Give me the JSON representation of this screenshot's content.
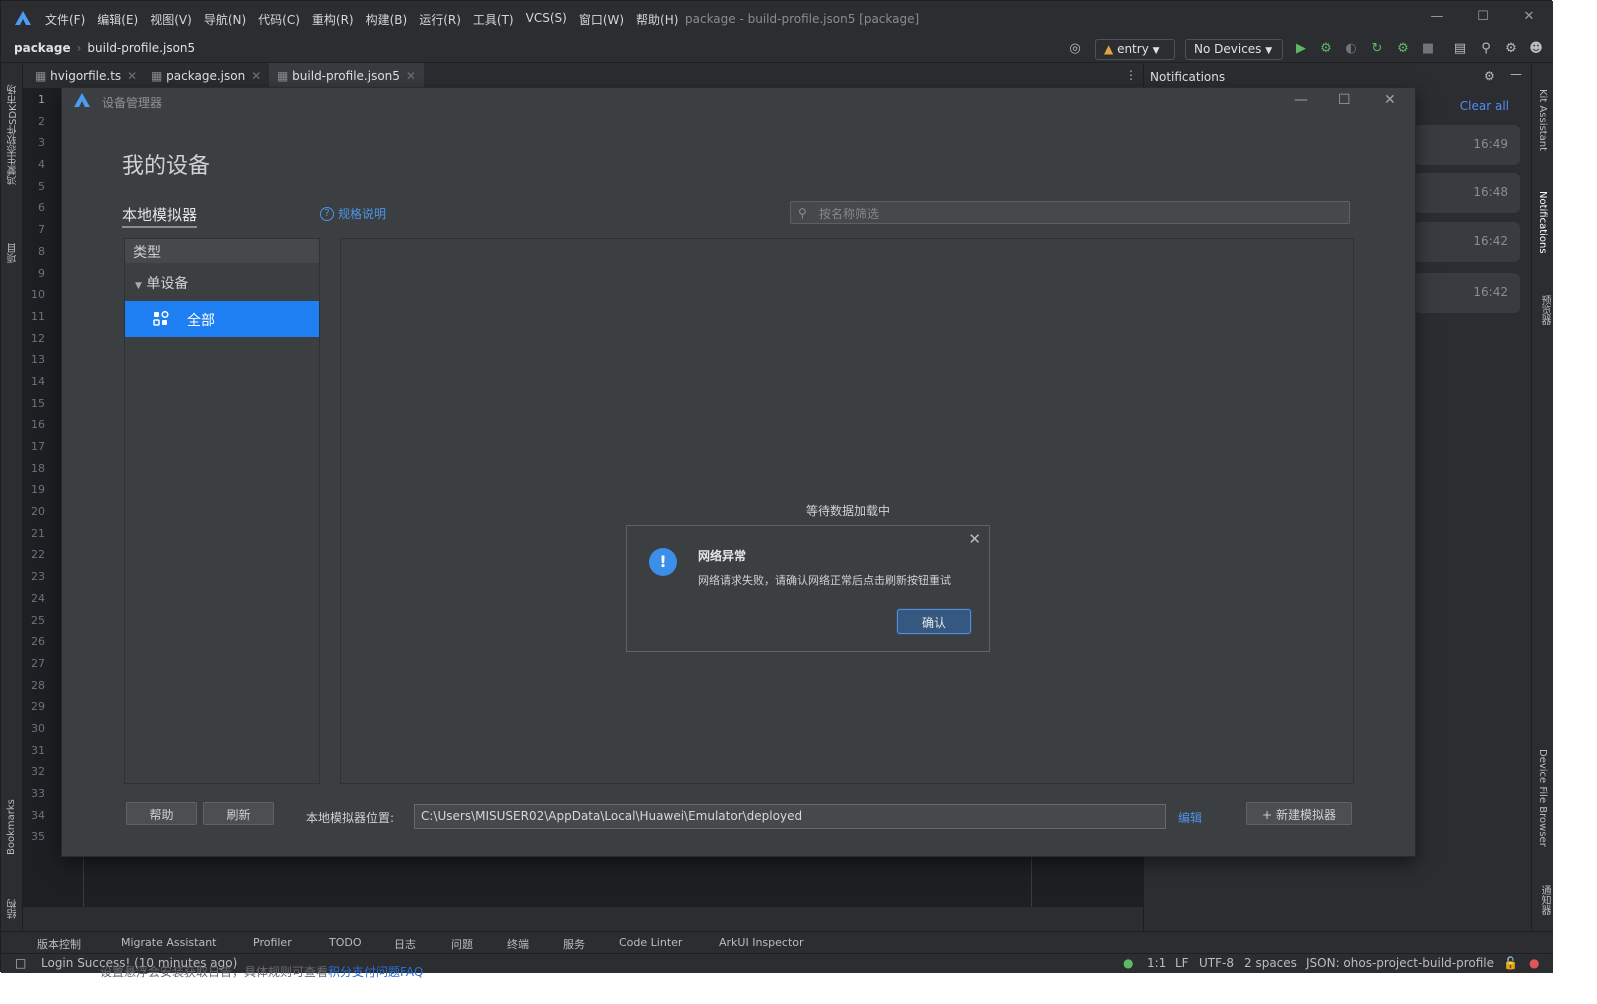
{
  "window_title": "package - build-profile.json5 [package]",
  "menu": [
    "文件(F)",
    "编辑(E)",
    "视图(V)",
    "导航(N)",
    "代码(C)",
    "重构(R)",
    "构建(B)",
    "运行(R)",
    "工具(T)",
    "VCS(S)",
    "窗口(W)",
    "帮助(H)"
  ],
  "breadcrumb": {
    "project": "package",
    "file": "build-profile.json5"
  },
  "toolbar": {
    "module": "entry",
    "device": "No Devices"
  },
  "tabs": [
    {
      "label": "hvigorfile.ts"
    },
    {
      "label": "package.json"
    },
    {
      "label": "build-profile.json5"
    }
  ],
  "left_strip": {
    "sdk": "鸿蒙生态软件SDK市场",
    "project": "项目",
    "bookmarks": "Bookmarks",
    "structure": "结构"
  },
  "right_strip": {
    "kit": "Kit Assistant",
    "notifications": "Notifications",
    "preview": "预览器",
    "device_browser": "Device File Browser",
    "other": "通知器"
  },
  "line_numbers": [
    "1",
    "2",
    "3",
    "4",
    "5",
    "6",
    "7",
    "8",
    "9",
    "10",
    "11",
    "12",
    "13",
    "14",
    "15",
    "16",
    "17",
    "18",
    "19",
    "20",
    "21",
    "22",
    "23",
    "24",
    "25",
    "26",
    "27",
    "28",
    "29",
    "30",
    "31",
    "32",
    "33",
    "34",
    "35"
  ],
  "notifications": {
    "header": "Notifications",
    "clear_all": "Clear all",
    "times": [
      "16:49",
      "16:48",
      "16:42",
      "16:42"
    ]
  },
  "dialog": {
    "title": "设备管理器",
    "heading": "我的设备",
    "local_tab": "本地模拟器",
    "spec_link": "规格说明",
    "search_placeholder": "按名称筛选",
    "type_header": "类型",
    "single_device": "单设备",
    "all_item": "全部",
    "loading": "等待数据加载中",
    "help_button": "帮助",
    "refresh_button": "刷新",
    "location_label": "本地模拟器位置:",
    "location_value": "C:\\Users\\MISUSER02\\AppData\\Local\\Huawei\\Emulator\\deployed",
    "edit_link": "编辑",
    "new_emulator_button": "新建模拟器"
  },
  "alert": {
    "title": "网络异常",
    "message": "网络请求失败，请确认网络正常后点击刷新按钮重试",
    "ok_button": "确认"
  },
  "bottom_tools": [
    "版本控制",
    "Migrate Assistant",
    "Profiler",
    "TODO",
    "日志",
    "问题",
    "终端",
    "服务",
    "Code Linter",
    "ArkUI Inspector"
  ],
  "status": {
    "message": "Login Success! (10 minutes ago)",
    "position": "1:1",
    "line_sep": "LF",
    "encoding": "UTF-8",
    "indent": "2 spaces",
    "schema": "JSON: ohos-project-build-profile"
  },
  "underlay_text": {
    "text": "设置悬浮会安装获取日告，具体规则可查看",
    "link": "积分支付问题FAQ"
  },
  "colors": {
    "accent": "#3574f0",
    "selection": "#1e7ff2",
    "run": "#5fb865"
  }
}
